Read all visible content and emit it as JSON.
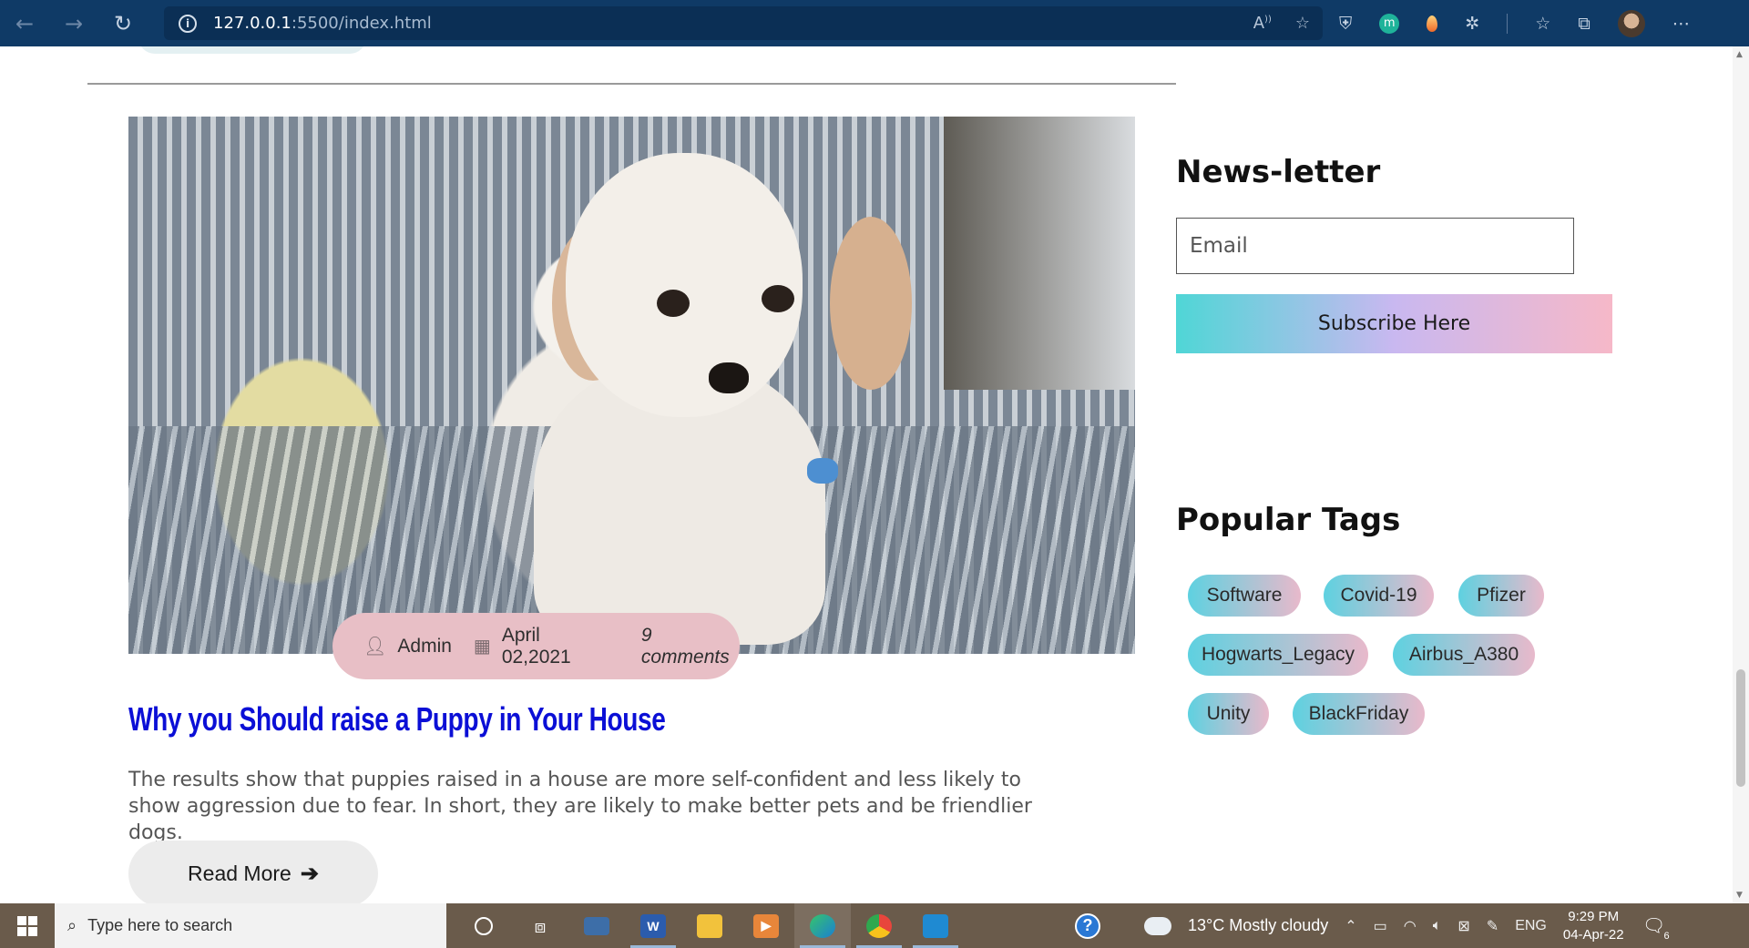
{
  "browser": {
    "url_host": "127.0.0.1",
    "url_path": ":5500/index.html",
    "info_glyph": "i"
  },
  "post": {
    "meta": {
      "author": "Admin",
      "date": "April 02,2021",
      "comments": "9 comments"
    },
    "title": "Why you Should raise a Puppy in Your House",
    "excerpt": "The results show that puppies raised in a house are more self-confident and less likely to show aggression due to fear. In short, they are likely to make better pets and be friendlier dogs.",
    "read_more_label": "Read More",
    "read_more_arrow": "➔"
  },
  "sidebar": {
    "newsletter_title": "News-letter",
    "email_placeholder": "Email",
    "subscribe_label": "Subscribe Here",
    "tags_title": "Popular Tags",
    "tags": [
      "Software",
      "Covid-19",
      "Pfizer",
      "Hogwarts_Legacy",
      "Airbus_A380",
      "Unity",
      "BlackFriday"
    ]
  },
  "taskbar": {
    "search_placeholder": "Type here to search",
    "weather": "13°C  Mostly cloudy",
    "language": "ENG",
    "time": "9:29 PM",
    "date": "04-Apr-22",
    "notification_count": "6",
    "apps": {
      "word": "W"
    }
  },
  "colors": {
    "title_blue": "#0b0fd6",
    "meta_pill": "#e8bfc6",
    "tag_gradient_start": "#5ed1e0",
    "tag_gradient_end": "#e8b9cb",
    "browser_bar": "#0f3a66"
  }
}
